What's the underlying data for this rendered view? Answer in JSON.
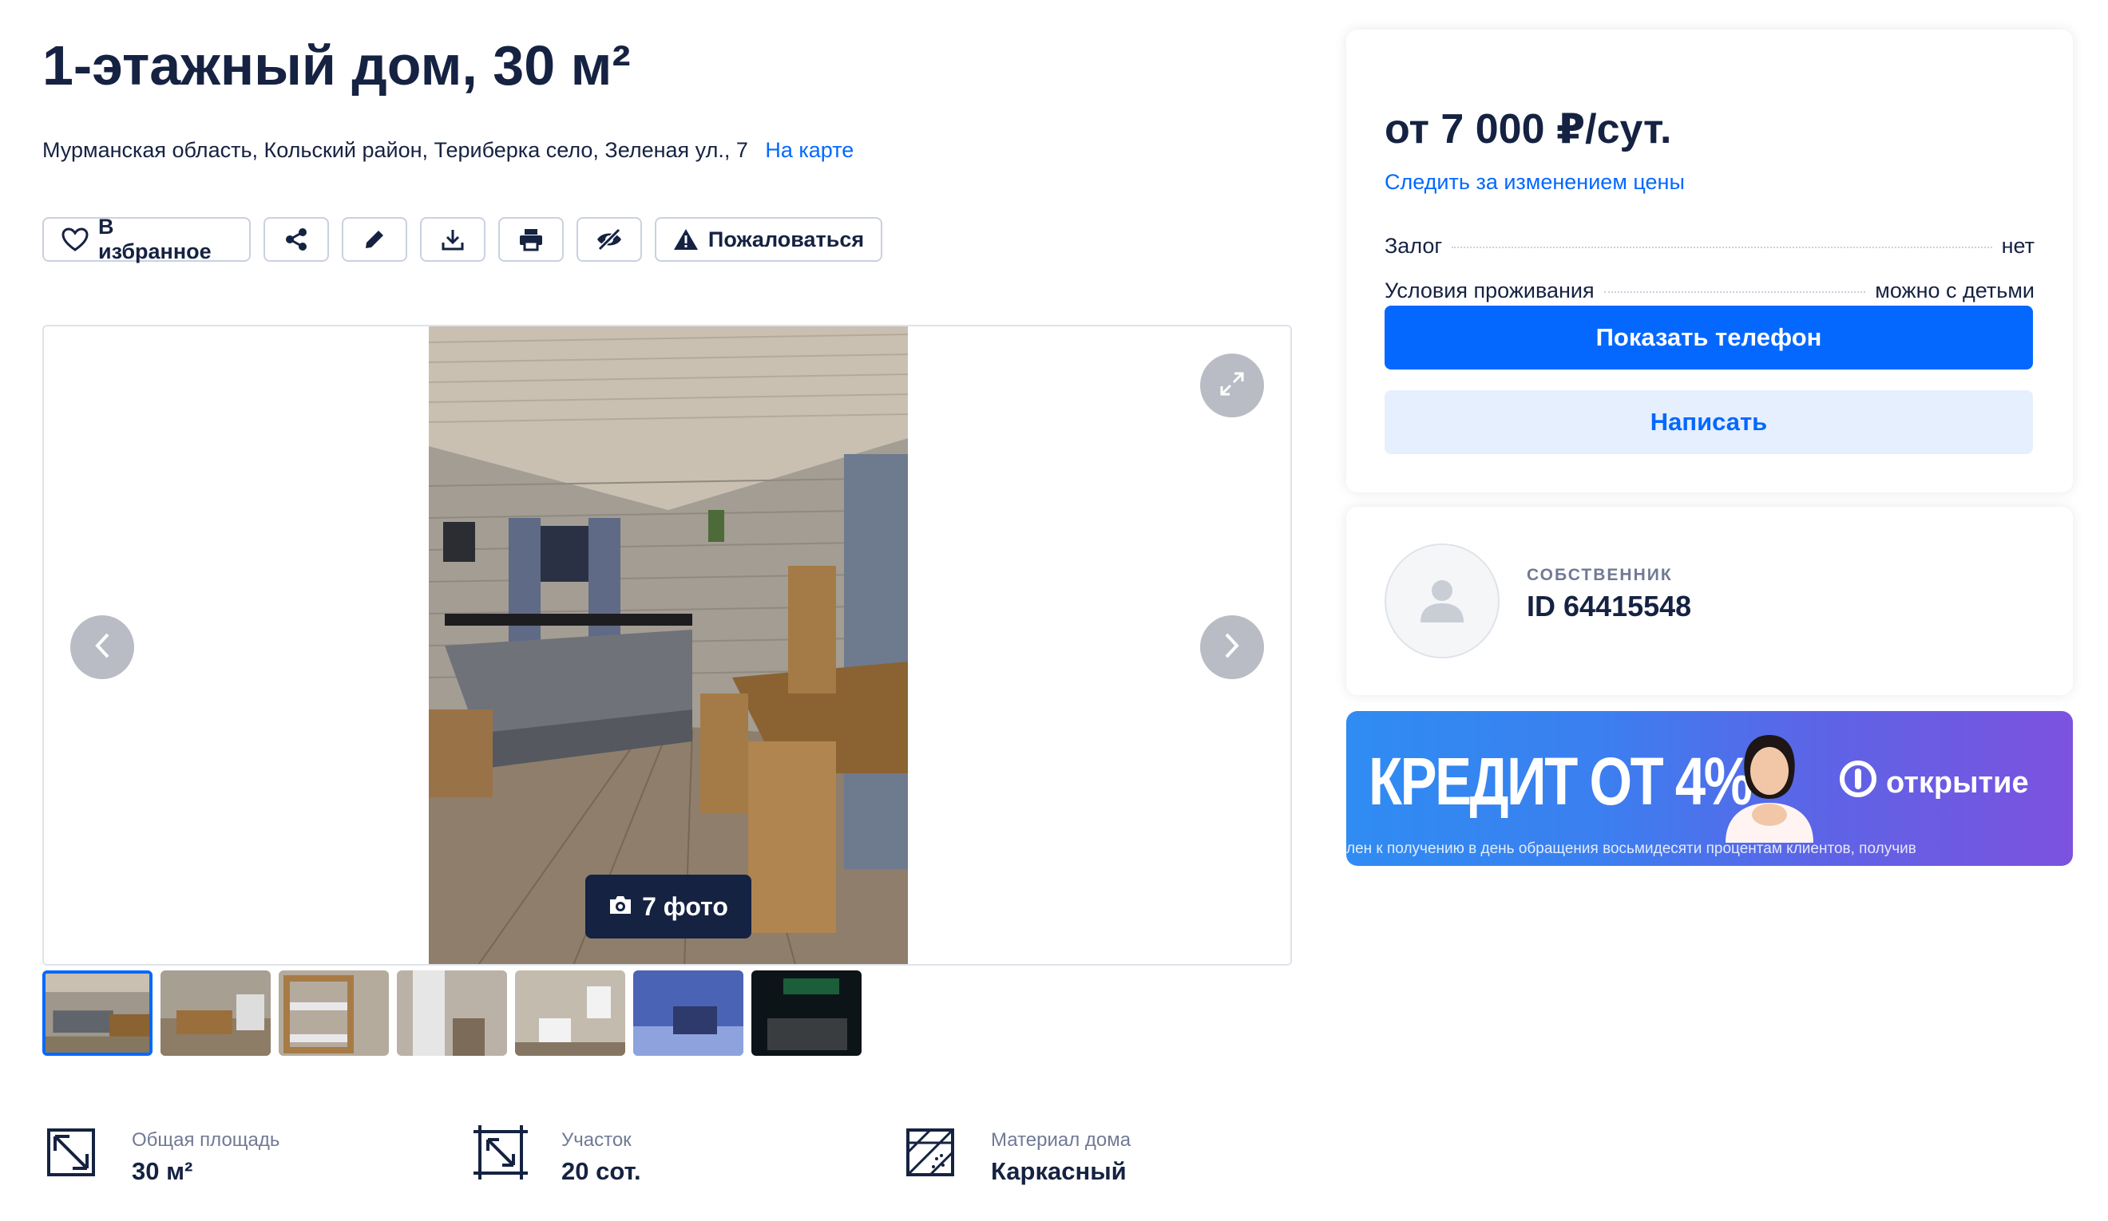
{
  "title": "1-этажный дом, 30 м²",
  "address": {
    "text": "Мурманская область, Кольский район, Териберка село, Зеленая ул., 7",
    "map_link": "На карте"
  },
  "actions": {
    "favorite": "В избранное",
    "complain": "Пожаловаться"
  },
  "gallery": {
    "photo_count": "7 фото",
    "thumbnails_count": 7,
    "active_thumbnail": 1
  },
  "specs": [
    {
      "label": "Общая площадь",
      "value": "30 м²",
      "icon": "area-icon"
    },
    {
      "label": "Участок",
      "value": "20 сот.",
      "icon": "plot-icon"
    },
    {
      "label": "Материал дома",
      "value": "Каркасный",
      "icon": "material-icon"
    }
  ],
  "price_card": {
    "price": "от 7 000 ₽/сут.",
    "follow": "Следить за изменением цены",
    "deposit_label": "Залог",
    "deposit_value": "нет",
    "conditions_label": "Условия проживания",
    "conditions_value": "можно с детьми",
    "show_phone": "Показать телефон",
    "write": "Написать"
  },
  "owner": {
    "role": "СОБСТВЕННИК",
    "id": "ID 64415548"
  },
  "ad": {
    "headline": "КРЕДИТ ОТ 4%",
    "brand": "открытие",
    "disclaimer": "лен к получению в день обращения восьмидесяти процентам клиентов, получив"
  },
  "colors": {
    "accent": "#0468ff",
    "text": "#152242",
    "muted": "#707a95",
    "border": "#c9d1e0"
  }
}
